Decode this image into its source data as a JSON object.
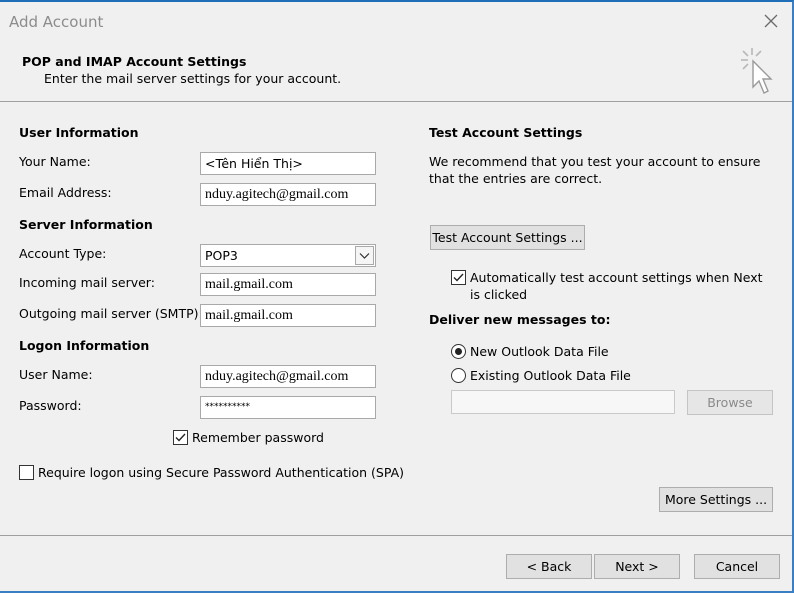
{
  "window": {
    "title": "Add Account",
    "close_symbol": "✕"
  },
  "header": {
    "title": "POP and IMAP Account Settings",
    "subtitle": "Enter the mail server settings for your account.",
    "icon": "wizard-cursor-icon"
  },
  "user_info": {
    "title": "User Information",
    "your_name_label": "Your Name:",
    "your_name_value": "<Tên Hiển Thị>",
    "email_label": "Email Address:",
    "email_value": "nduy.agitech@gmail.com"
  },
  "server_info": {
    "title": "Server Information",
    "account_type_label": "Account Type:",
    "account_type_value": "POP3",
    "incoming_label": "Incoming mail server:",
    "incoming_value": "mail.gmail.com",
    "outgoing_label": "Outgoing mail server (SMTP):",
    "outgoing_value": "mail.gmail.com"
  },
  "logon_info": {
    "title": "Logon Information",
    "username_label": "User Name:",
    "username_value": "nduy.agitech@gmail.com",
    "password_label": "Password:",
    "password_value": "**********",
    "remember_label": "Remember password",
    "remember_checked": true,
    "spa_label": "Require logon using Secure Password Authentication (SPA)",
    "spa_checked": false
  },
  "test_settings": {
    "title": "Test Account Settings",
    "description": "We recommend that you test your account to ensure that the entries are correct.",
    "test_button": "Test Account Settings ...",
    "auto_test_label": "Automatically test account settings when Next is clicked",
    "auto_test_checked": true
  },
  "deliver": {
    "title": "Deliver new messages to:",
    "new_file_label": "New Outlook Data File",
    "existing_file_label": "Existing Outlook Data File",
    "selected": "new",
    "browse_button": "Browse",
    "path_value": ""
  },
  "buttons": {
    "more_settings": "More Settings ...",
    "back": "< Back",
    "next": "Next >",
    "cancel": "Cancel"
  }
}
